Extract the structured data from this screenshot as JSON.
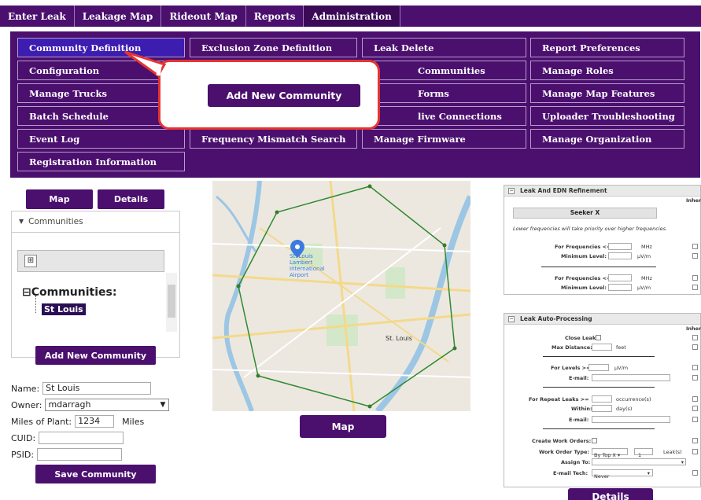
{
  "topnav": {
    "tabs": [
      "Enter Leak",
      "Leakage Map",
      "Rideout Map",
      "Reports",
      "Administration"
    ]
  },
  "admin_menu": {
    "col1": [
      "Community Definition",
      "Configuration",
      "Manage Trucks",
      "Batch Schedule",
      "Event Log",
      "Registration Information"
    ],
    "col2": [
      "Exclusion Zone Definition",
      "Frequency Mismatch Search"
    ],
    "col3": [
      "Leak Delete",
      "Communities",
      "Forms",
      "live Connections",
      "Manage Firmware"
    ],
    "col4": [
      "Report Preferences",
      "Manage Roles",
      "Manage Map Features",
      "Uploader Troubleshooting",
      "Manage Organization"
    ]
  },
  "callout": {
    "button_label": "Add New Community"
  },
  "left_panel": {
    "map_button": "Map",
    "details_button": "Details",
    "section_title": "Communities",
    "tree_root": "Communities:",
    "tree_node": "St Louis",
    "add_button": "Add New Community",
    "name_label": "Name:",
    "name_value": "St Louis",
    "owner_label": "Owner:",
    "owner_value": "mdarragh",
    "miles_label": "Miles of Plant:",
    "miles_value": "1234",
    "miles_unit": "Miles",
    "cuid_label": "CUID:",
    "psid_label": "PSID:",
    "save_button": "Save Community"
  },
  "map": {
    "city_label": "St. Louis",
    "airport_label": "St. Louis Lambert International Airport",
    "map_button": "Map"
  },
  "refinement_panel": {
    "title": "Leak And EDN Refinement",
    "inherit_label": "Inher",
    "seeker": "Seeker X",
    "note": "Lower frequencies will take priority over higher frequencies.",
    "freq_label": "For Frequencies <=",
    "freq_unit": "MHz",
    "min_level_label": "Minimum Level:",
    "level_unit": "μV/m"
  },
  "auto_panel": {
    "title": "Leak Auto-Processing",
    "inherit_label": "Inher",
    "close_leaks": "Close Leaks:",
    "max_distance": "Max Distance:",
    "feet": "feet",
    "for_levels": "For Levels >=",
    "level_unit": "μV/m",
    "email": "E-mail:",
    "repeat_leaks": "For Repeat Leaks >=",
    "occurrence": "occurrence(s)",
    "within": "Within:",
    "days": "day(s)",
    "create_work_orders": "Create Work Orders:",
    "work_order_type": "Work Order Type:",
    "work_order_value": "By Top X",
    "leak_count": "1",
    "leaks_label": "Leak(s)",
    "assign_to": "Assign To:",
    "email_tech": "E-mail Tech:",
    "email_tech_value": "Never",
    "details_button": "Details"
  },
  "colors": {
    "brand_purple": "#4b0f6e",
    "active_item": "#3c1db0",
    "callout_red": "#e53333"
  }
}
